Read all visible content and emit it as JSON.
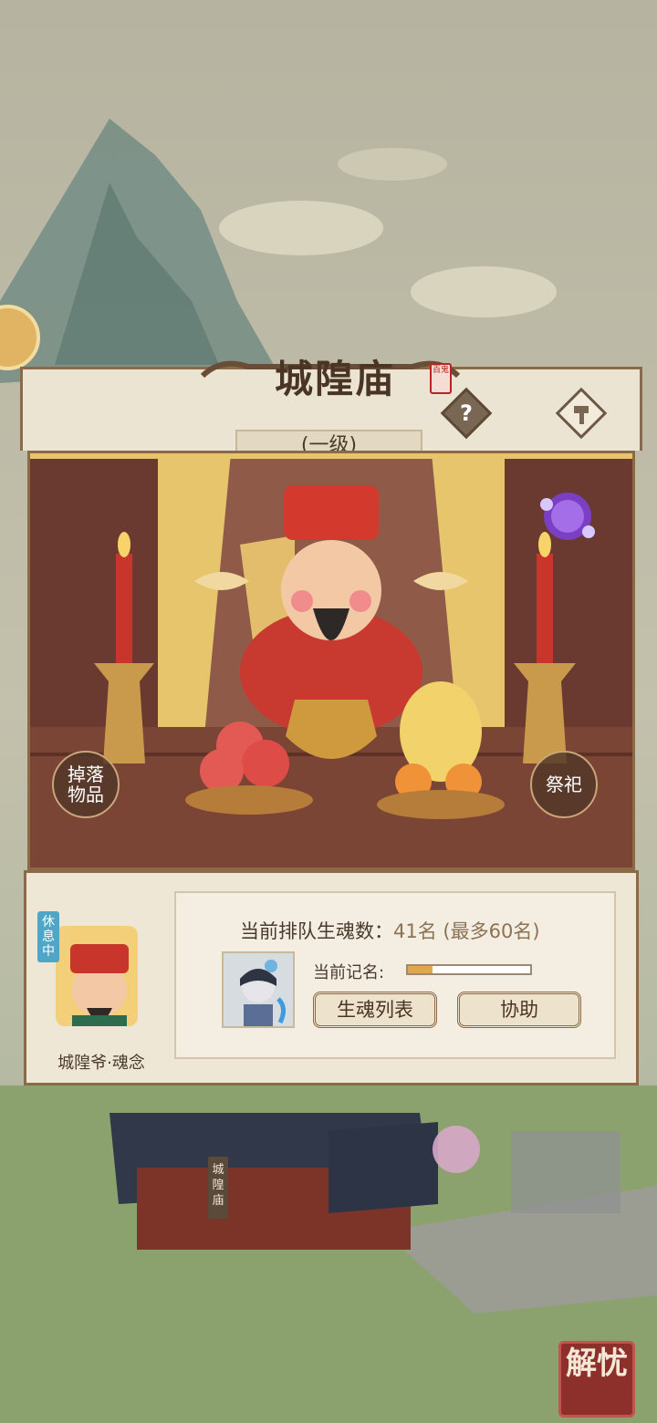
{
  "panel": {
    "title": "城隍庙",
    "seal_text": "百鬼",
    "level": "(一级)",
    "help_icon": "question-icon",
    "hammer_icon": "hammer-icon"
  },
  "scene": {
    "dropped_items_label": "掉落物品",
    "sacrifice_label": "祭祀",
    "spirit_icon": "purple-spirit-icon"
  },
  "info": {
    "status_badge": "休息中",
    "npc_name": "城隍爷·魂念",
    "queue_label": "当前排队生魂数：",
    "queue_count": "41名",
    "queue_max": "(最多60名)",
    "current_record_label": "当前记名:",
    "current_record_progress": 0.2,
    "soul_list_button": "生魂列表",
    "assist_button": "协助"
  },
  "map": {
    "temple_label": "城隍庙",
    "corner_button": "解忧"
  },
  "colors": {
    "frame": "#8c6a48",
    "panel_bg": "#efe7d6",
    "accent_progress": "#e0a84c",
    "status_badge": "#4fa6c6",
    "corner_button": "#8d2f2a"
  }
}
